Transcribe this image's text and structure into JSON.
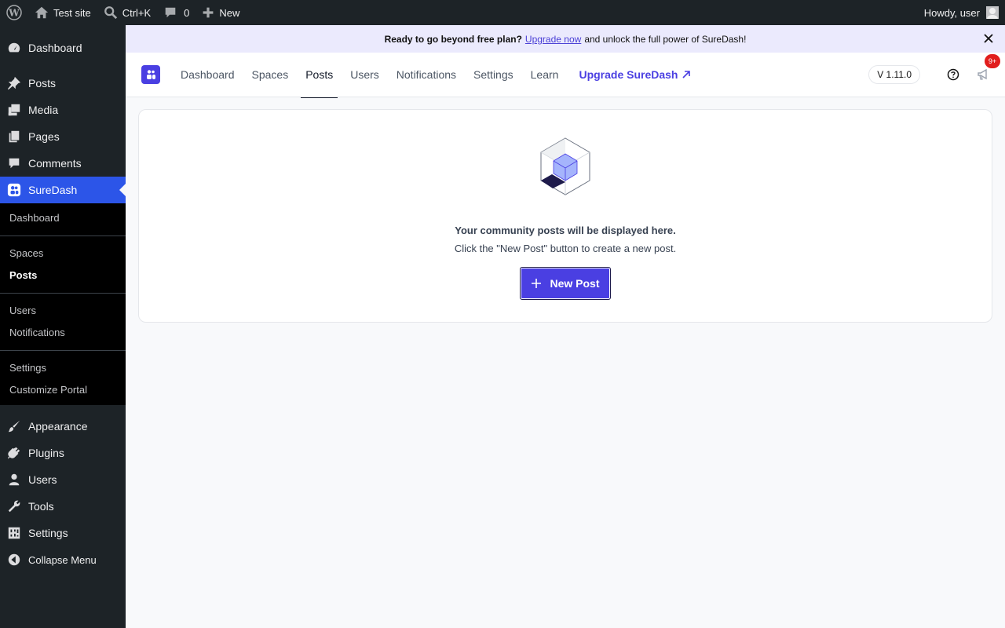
{
  "adminbar": {
    "site_name": "Test site",
    "search_shortcut": "Ctrl+K",
    "comments_count": "0",
    "new_label": "New",
    "howdy": "Howdy, user"
  },
  "sidebar": {
    "items": [
      {
        "label": "Dashboard",
        "icon": "dashboard-icon"
      },
      {
        "label": "Posts",
        "icon": "pin-icon"
      },
      {
        "label": "Media",
        "icon": "media-icon"
      },
      {
        "label": "Pages",
        "icon": "pages-icon"
      },
      {
        "label": "Comments",
        "icon": "comment-icon"
      },
      {
        "label": "SureDash",
        "icon": "suredash-icon"
      }
    ],
    "submenu": {
      "dashboard": "Dashboard",
      "spaces": "Spaces",
      "posts": "Posts",
      "users": "Users",
      "notifications": "Notifications",
      "settings": "Settings",
      "customize_portal": "Customize Portal"
    },
    "lower_items": [
      {
        "label": "Appearance",
        "icon": "brush-icon"
      },
      {
        "label": "Plugins",
        "icon": "plugin-icon"
      },
      {
        "label": "Users",
        "icon": "user-icon"
      },
      {
        "label": "Tools",
        "icon": "wrench-icon"
      },
      {
        "label": "Settings",
        "icon": "settings-icon"
      }
    ],
    "collapse": "Collapse Menu"
  },
  "notice": {
    "lead": "Ready to go beyond free plan?",
    "link": "Upgrade now",
    "tail": "and unlock the full power of SureDash!"
  },
  "topnav": {
    "tabs": [
      "Dashboard",
      "Spaces",
      "Posts",
      "Users",
      "Notifications",
      "Settings",
      "Learn"
    ],
    "upgrade": "Upgrade SureDash",
    "version": "V 1.11.0",
    "badge": "9+"
  },
  "empty_state": {
    "title": "Your community posts will be displayed here.",
    "subtitle": "Click the \"New Post\" button to create a new post.",
    "button": "New Post"
  },
  "colors": {
    "accent": "#4a3fe2",
    "wp_admin_active": "#2c55e8",
    "admin_bg": "#1d2327"
  }
}
